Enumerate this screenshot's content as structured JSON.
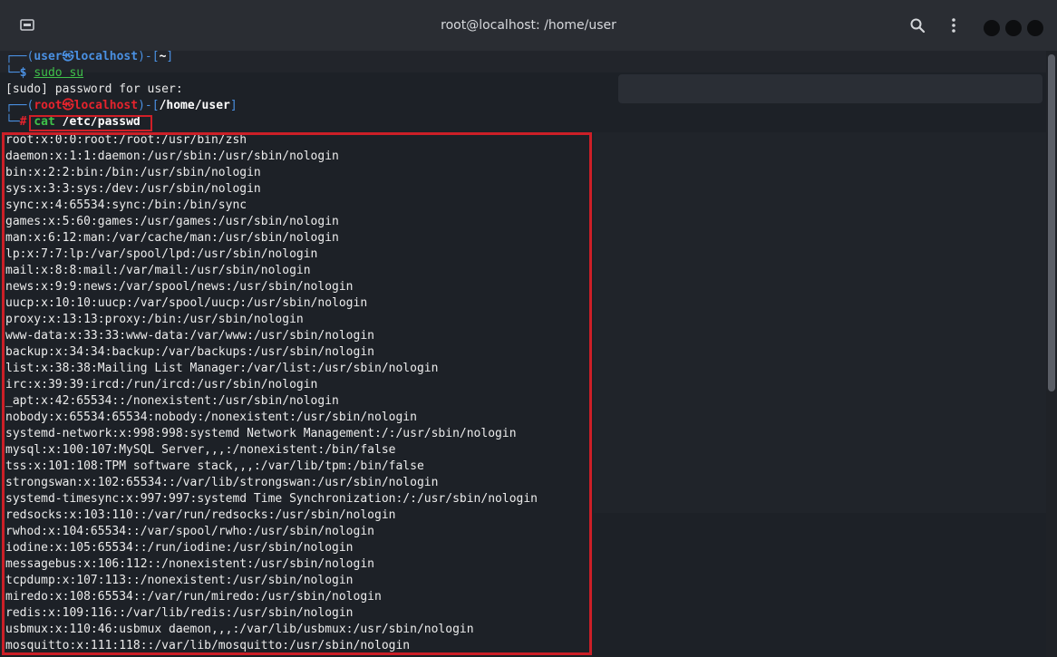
{
  "window": {
    "title": "root@localhost: /home/user"
  },
  "prompt1": {
    "open": "┌──(",
    "user": "user",
    "at": "㉿",
    "host": "localhost",
    "close": ")-[",
    "dir": "~",
    "end": "]"
  },
  "line2": {
    "prefix": "└─",
    "sign": "$ ",
    "cmd": "sudo su"
  },
  "line3": "[sudo] password for user:",
  "prompt2": {
    "open": "┌──(",
    "user": "root",
    "at": "㉿",
    "host": "localhost",
    "close": ")-[",
    "dir": "/home/user",
    "end": "]"
  },
  "line5": {
    "prefix": "└─",
    "sign": "# ",
    "cmd": "cat",
    "arg": " /etc/passwd"
  },
  "output": [
    "root:x:0:0:root:/root:/usr/bin/zsh",
    "daemon:x:1:1:daemon:/usr/sbin:/usr/sbin/nologin",
    "bin:x:2:2:bin:/bin:/usr/sbin/nologin",
    "sys:x:3:3:sys:/dev:/usr/sbin/nologin",
    "sync:x:4:65534:sync:/bin:/bin/sync",
    "games:x:5:60:games:/usr/games:/usr/sbin/nologin",
    "man:x:6:12:man:/var/cache/man:/usr/sbin/nologin",
    "lp:x:7:7:lp:/var/spool/lpd:/usr/sbin/nologin",
    "mail:x:8:8:mail:/var/mail:/usr/sbin/nologin",
    "news:x:9:9:news:/var/spool/news:/usr/sbin/nologin",
    "uucp:x:10:10:uucp:/var/spool/uucp:/usr/sbin/nologin",
    "proxy:x:13:13:proxy:/bin:/usr/sbin/nologin",
    "www-data:x:33:33:www-data:/var/www:/usr/sbin/nologin",
    "backup:x:34:34:backup:/var/backups:/usr/sbin/nologin",
    "list:x:38:38:Mailing List Manager:/var/list:/usr/sbin/nologin",
    "irc:x:39:39:ircd:/run/ircd:/usr/sbin/nologin",
    "_apt:x:42:65534::/nonexistent:/usr/sbin/nologin",
    "nobody:x:65534:65534:nobody:/nonexistent:/usr/sbin/nologin",
    "systemd-network:x:998:998:systemd Network Management:/:/usr/sbin/nologin",
    "mysql:x:100:107:MySQL Server,,,:/nonexistent:/bin/false",
    "tss:x:101:108:TPM software stack,,,:/var/lib/tpm:/bin/false",
    "strongswan:x:102:65534::/var/lib/strongswan:/usr/sbin/nologin",
    "systemd-timesync:x:997:997:systemd Time Synchronization:/:/usr/sbin/nologin",
    "redsocks:x:103:110::/var/run/redsocks:/usr/sbin/nologin",
    "rwhod:x:104:65534::/var/spool/rwho:/usr/sbin/nologin",
    "iodine:x:105:65534::/run/iodine:/usr/sbin/nologin",
    "messagebus:x:106:112::/nonexistent:/usr/sbin/nologin",
    "tcpdump:x:107:113::/nonexistent:/usr/sbin/nologin",
    "miredo:x:108:65534::/var/run/miredo:/usr/sbin/nologin",
    "redis:x:109:116::/var/lib/redis:/usr/sbin/nologin",
    "usbmux:x:110:46:usbmux daemon,,,:/var/lib/usbmux:/usr/sbin/nologin",
    "mosquitto:x:111:118::/var/lib/mosquitto:/usr/sbin/nologin"
  ],
  "icons": {
    "tab": "new-tab-icon",
    "search": "search-icon",
    "menu": "kebab-menu-icon"
  },
  "colors": {
    "user_prompt": "#4a90e2",
    "root_prompt": "#e5232d",
    "highlight_box": "#cc1f27"
  }
}
